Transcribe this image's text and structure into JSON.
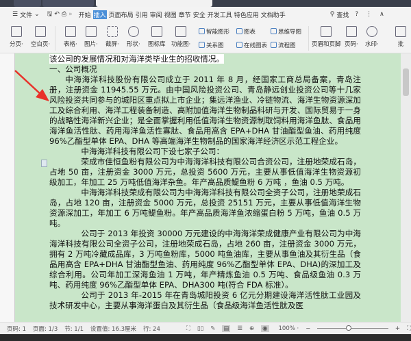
{
  "menu": {
    "file": "文件",
    "items": [
      "开始",
      "插入",
      "页面布局",
      "引用",
      "审阅",
      "视图",
      "章节",
      "安全",
      "开发工具",
      "特色应用",
      "文档助手"
    ],
    "active": "插入",
    "search": "查找",
    "help": "?"
  },
  "ribbon": {
    "big": [
      {
        "label": "分页·"
      },
      {
        "label": "空白页·"
      },
      {
        "label": "表格·"
      },
      {
        "label": "图片·"
      },
      {
        "label": "截屏·"
      },
      {
        "label": "形状·"
      },
      {
        "label": "图标库"
      },
      {
        "label": "功能图·"
      }
    ],
    "small": [
      "智能图形",
      "图表",
      "思维导图",
      "关系图",
      "在线图表",
      "流程图"
    ],
    "right": [
      {
        "label": "页眉和页脚"
      },
      {
        "label": "页码·"
      },
      {
        "label": "水印·"
      },
      {
        "label": "批"
      }
    ]
  },
  "document": {
    "paragraphs": [
      "该公司的发展情况和对海洋类毕业生的招收情况。",
      "一、公司概况",
      "中海海洋科技股份有限公司成立于 2011 年 8 月，经国家工商总局备案，青岛注册，注册资金 11945.55 万元。由中国风险投资公司、青岛静远创业投资公司等十几家风险投资共同参与的城阳区重点拟上市企业；集远洋渔业、冷链物流、海洋生物资源深加工及综合利用、海洋工程装备制造、高附加值海洋生物制品科研与开发、国际贸易于一身的战略性海洋新兴企业；是全面掌握利用低值海洋生物资源制取饲料用海洋鱼肽、食品用海洋鱼活性肽、药用海洋鱼活性寡肽、食品用高含 EPA+DHA 甘油酯型鱼油、药用纯度 96%乙酯型单体 EPA、DHA 等高端海洋生物制品的国家海洋经济区示范工程企业。",
      "中海海洋科技有限公司下设七家子公司：",
      "荣成市佳恒鱼粉有限公司为中海海洋科技有限公司合资公司，注册地荣成石岛，占地 50 亩，注册资金 3000 万元，总投资 5600 万元，主要从事低值海洋生物资源初级加工，年加工 25 万吨低值海洋杂鱼。年产高品质鳀鱼粉 6 万吨 ，鱼油 0.5 万吨。",
      "中海海洋科技荣成有限公司为中海海洋科技有限公司全资子公司，注册地荣成石岛，占地 120 亩，注册资金 5000 万元，总投资 25151 万元，主要从事低值海洋生物资源深加工，年加工 6 万吨鳀鱼粉。年产高品质海洋鱼浓缩蛋白粉 5 万吨，鱼油 0.5 万吨。",
      "公司于 2013 年投资 30000 万元建设的中海海洋荣成健康产业有限公司为中海海洋科技有限公司全资子公司，注册地荣成石岛，占地 260 亩，注册资金 3000 万元，拥有 2 万吨冷藏成品库，3 万吨鱼粉库，5000 吨鱼油库，主要从事鱼油及其衍生品（食品用高含 EPA+DHA 甘油酯型鱼油、药用纯度 96%乙酯型单体 EPA、DHA)的深加工及综合利用。公司年加工深海鱼油 1 万吨，年产精炼鱼油 0.5 万吨、食品级鱼油 0.3 万吨、药用纯度 96%乙酯型单体 EPA、DHA300 吨(符合 FDA 标准）。",
      "公司于 2013 年-2015 年在青岛城阳投资 6 亿元分期建设海洋活性肽工业园及技术研发中心，主要从事海洋蛋白及其衍生品（食品级海洋鱼活性肽及医"
    ]
  },
  "status": {
    "page": "页码: 1",
    "pages": "页面: 1/3",
    "section": "节: 1/1",
    "setting": "设置值: 16.3厘米",
    "line": "行: 24",
    "zoom": "100% ·",
    "zoom_percent": 100
  },
  "colors": {
    "doc_bg": "#c9e6c9",
    "accent": "#4a8fd8",
    "arrow": "#e8322a"
  }
}
